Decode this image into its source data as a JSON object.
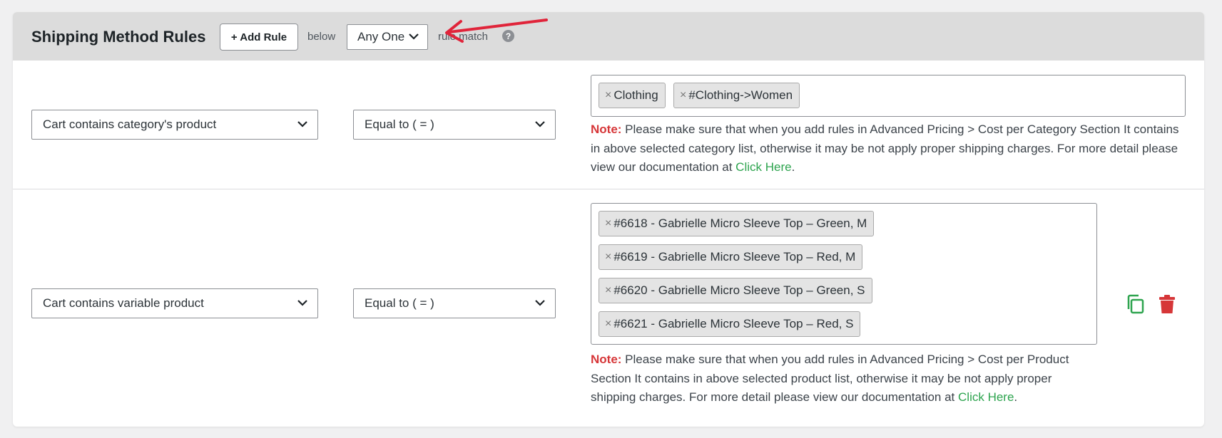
{
  "header": {
    "title": "Shipping Method Rules",
    "add_rule_label": "+ Add Rule",
    "below_text": "below",
    "match_selected": "Any One",
    "rule_match_text": "rule match",
    "help_glyph": "?"
  },
  "rules": [
    {
      "condition": "Cart contains category's product",
      "operator": "Equal to ( = )",
      "tags": [
        "Clothing",
        "#Clothing->Women"
      ],
      "note_label": "Note:",
      "note_text": " Please make sure that when you add rules in Advanced Pricing > Cost per Category Section It contains in above selected category list, otherwise it may be not apply proper shipping charges. For more detail please view our documentation at ",
      "note_link": "Click Here",
      "note_end": "."
    },
    {
      "condition": "Cart contains variable product",
      "operator": "Equal to ( = )",
      "tags": [
        "#6618 - Gabrielle Micro Sleeve Top – Green, M",
        "#6619 - Gabrielle Micro Sleeve Top – Red, M",
        "#6620 - Gabrielle Micro Sleeve Top – Green, S",
        "#6621 - Gabrielle Micro Sleeve Top – Red, S"
      ],
      "note_label": "Note:",
      "note_text": " Please make sure that when you add rules in Advanced Pricing > Cost per Product Section It contains in above selected product list, otherwise it may be not apply proper shipping charges. For more detail please view our documentation at ",
      "note_link": "Click Here",
      "note_end": "."
    }
  ],
  "tag_remove_glyph": "×",
  "icons": {
    "duplicate": "duplicate-icon",
    "delete": "trash-icon",
    "chevron": "chevron-down-icon",
    "arrow": "red-arrow-annotation"
  },
  "colors": {
    "header_bg": "#dcdcdc",
    "note_red": "#d63638",
    "link_green": "#2ea44f",
    "duplicate_green": "#2ea44f",
    "delete_red": "#d63638",
    "arrow_red": "#e0243a"
  }
}
